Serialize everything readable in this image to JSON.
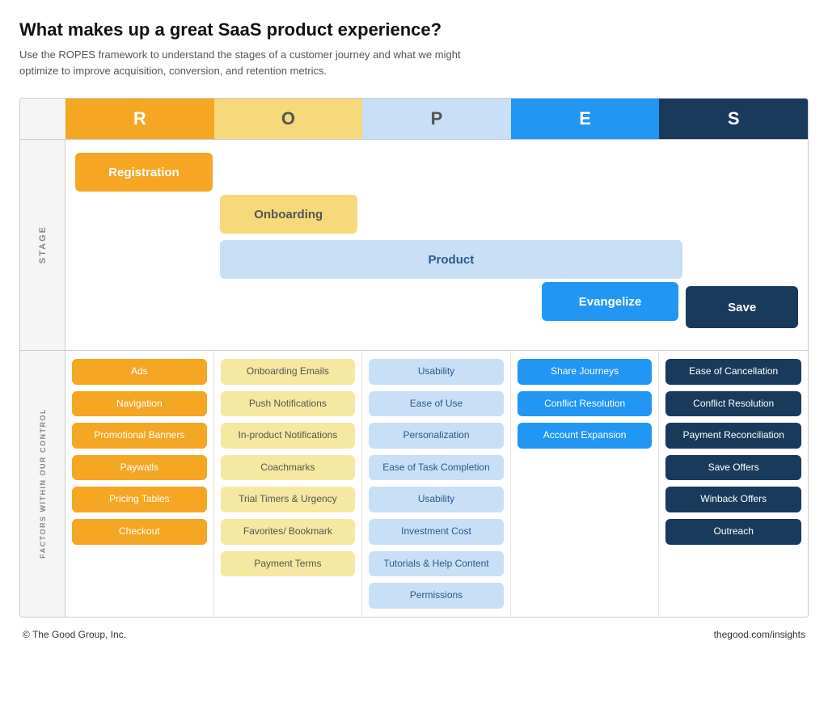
{
  "title": "What makes up a great SaaS product experience?",
  "subtitle": "Use the ROPES framework to understand the stages of a customer journey and what we might optimize to improve acquisition, conversion, and retention metrics.",
  "header": {
    "letters": [
      "R",
      "O",
      "P",
      "E",
      "S"
    ]
  },
  "stage_label": "STAGE",
  "factors_label": "FACTORS WITHIN OUR CONTROL",
  "stages": {
    "registration": "Registration",
    "onboarding": "Onboarding",
    "product": "Product",
    "evangelize": "Evangelize",
    "save": "Save"
  },
  "factors": {
    "r": [
      "Ads",
      "Navigation",
      "Promotional Banners",
      "Paywalls",
      "Pricing Tables",
      "Checkout"
    ],
    "o": [
      "Onboarding Emails",
      "Push Notifications",
      "In-product Notifications",
      "Coachmarks",
      "Trial Timers & Urgency",
      "Favorites/ Bookmark",
      "Payment Terms"
    ],
    "p": [
      "Usability",
      "Ease of Use",
      "Personalization",
      "Ease of Task Completion",
      "Usability",
      "Investment Cost",
      "Tutorials & Help Content",
      "Permissions"
    ],
    "e": [
      "Share Journeys",
      "Conflict Resolution",
      "Account Expansion"
    ],
    "s": [
      "Ease of Cancellation",
      "Conflict Resolution",
      "Payment Reconciliation",
      "Save Offers",
      "Winback Offers",
      "Outreach"
    ]
  },
  "footer": {
    "left": "© The Good Group, Inc.",
    "right": "thegood.com/insights"
  }
}
